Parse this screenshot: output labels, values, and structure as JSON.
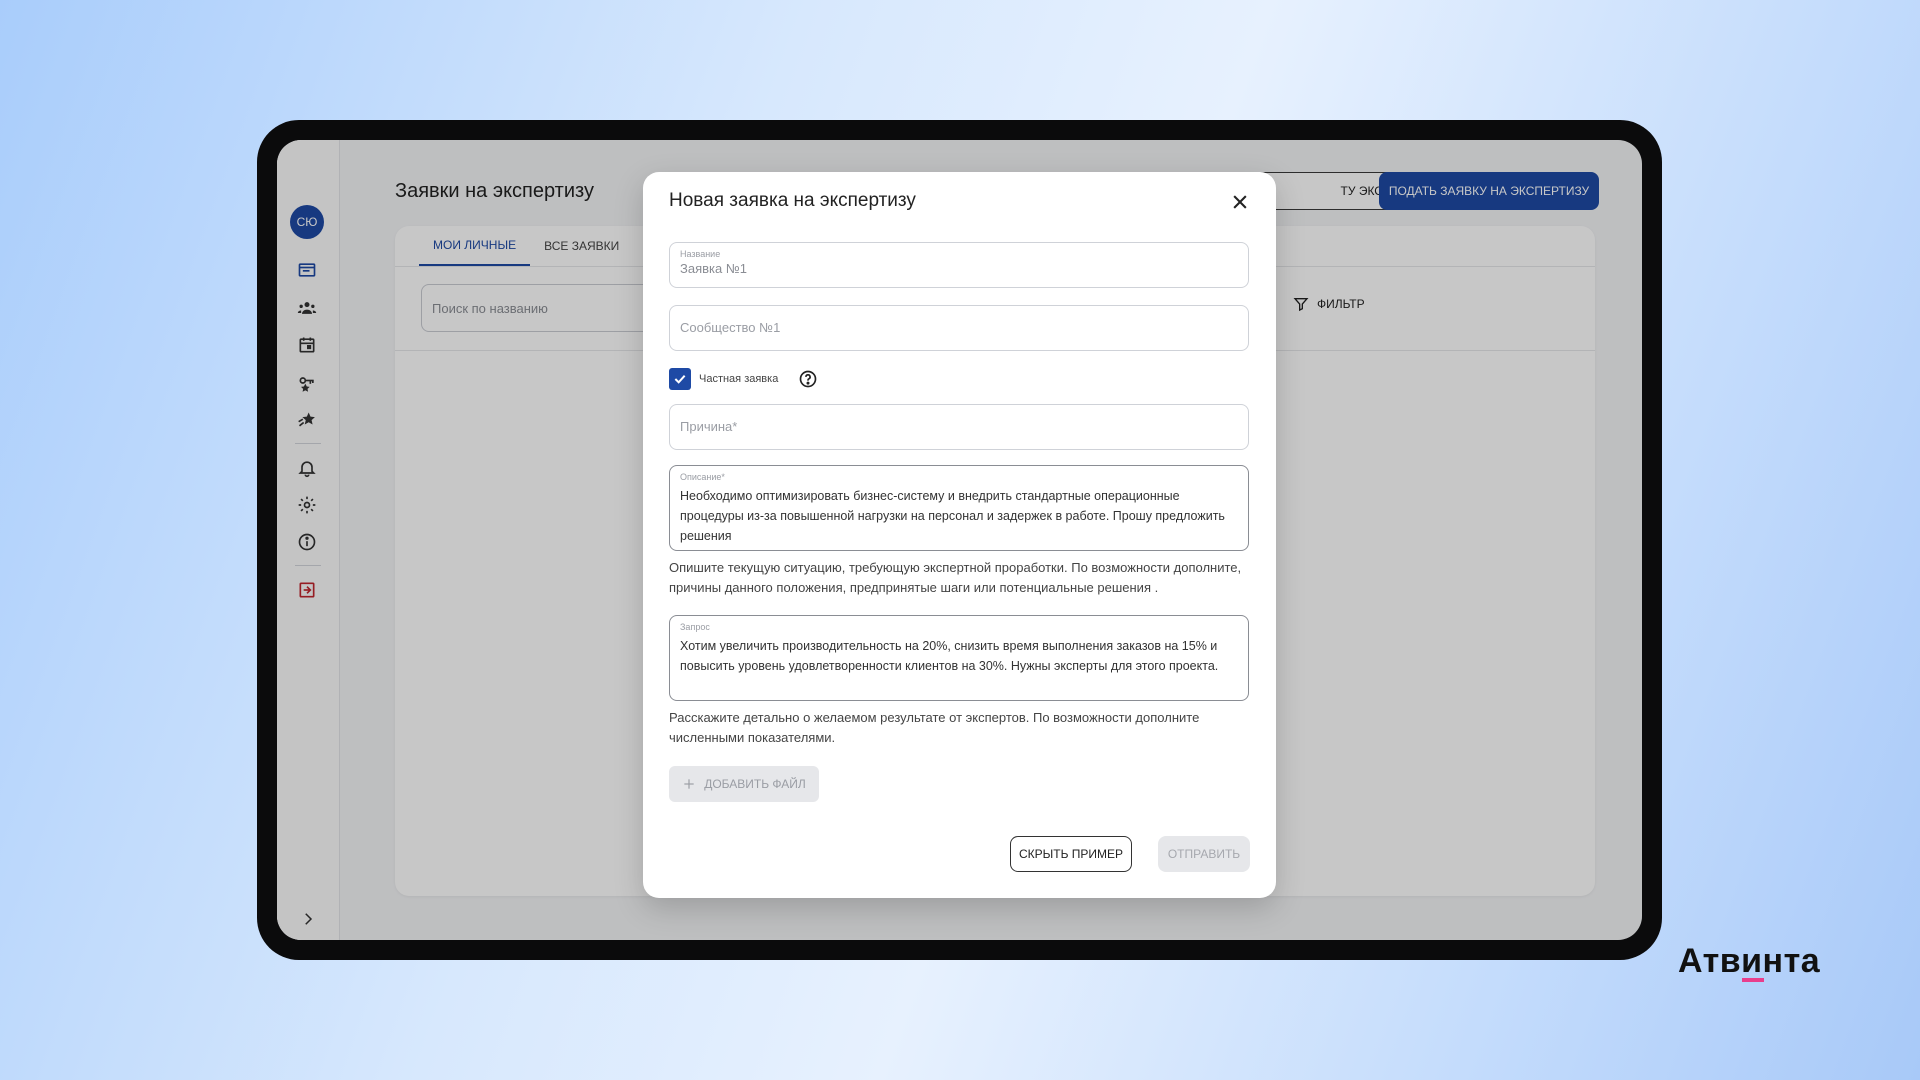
{
  "app": {
    "page_title": "Заявки на экспертизу",
    "header_outline_btn": "ТУ ЭКСПЕРТА",
    "header_primary_btn": "ПОДАТЬ ЗАЯВКУ НА ЭКСПЕРТИЗУ",
    "avatar_initials": "СЮ"
  },
  "sidebar": {
    "icons": [
      "folder-icon",
      "users-icon",
      "calendar-icon",
      "key-icon",
      "star-icon",
      "bell-icon",
      "gear-icon",
      "info-icon",
      "logout-icon"
    ],
    "accent": "#1e4aa5",
    "logout_color": "#c0262d"
  },
  "card": {
    "tabs": [
      {
        "label": "МОИ ЛИЧНЫЕ",
        "active": true
      },
      {
        "label": "ВСЕ ЗАЯВКИ",
        "active": false
      }
    ],
    "search_placeholder": "Поиск по названию",
    "filter_label": "ФИЛЬТР"
  },
  "modal": {
    "title": "Новая заявка на экспертизу",
    "name_field": {
      "label": "Название",
      "value": "Заявка №1"
    },
    "community_field": {
      "placeholder": "Сообщество №1"
    },
    "private_checkbox": {
      "label": "Частная заявка",
      "checked": true
    },
    "reason_field": {
      "placeholder": "Причина*"
    },
    "description_field": {
      "label": "Описание*",
      "value": "Необходимо оптимизировать бизнес-систему и внедрить стандартные операционные процедуры из-за повышенной нагрузки на персонал и задержек в работе. Прошу предложить решения"
    },
    "description_hint": "Опишите текущую ситуацию, требующую экспертной проработки. По возможности дополните, причины данного положения, предпринятые шаги или потенциальные решения .",
    "request_field": {
      "label": "Запрос",
      "value": "Хотим увеличить производительность на 20%, снизить время выполнения заказов на 15% и повысить уровень удовлетворенности клиентов на 30%. Нужны эксперты для этого проекта."
    },
    "request_hint": "Расскажите детально о желаемом результате от экспертов. По возможности дополните численными показателями.",
    "add_file_label": "ДОБАВИТЬ ФАЙЛ",
    "hide_example_label": "СКРЫТЬ ПРИМЕР",
    "submit_label": "ОТПРАВИТЬ"
  },
  "brand": {
    "name": "Атвинта",
    "accent": "#e83e8c"
  }
}
